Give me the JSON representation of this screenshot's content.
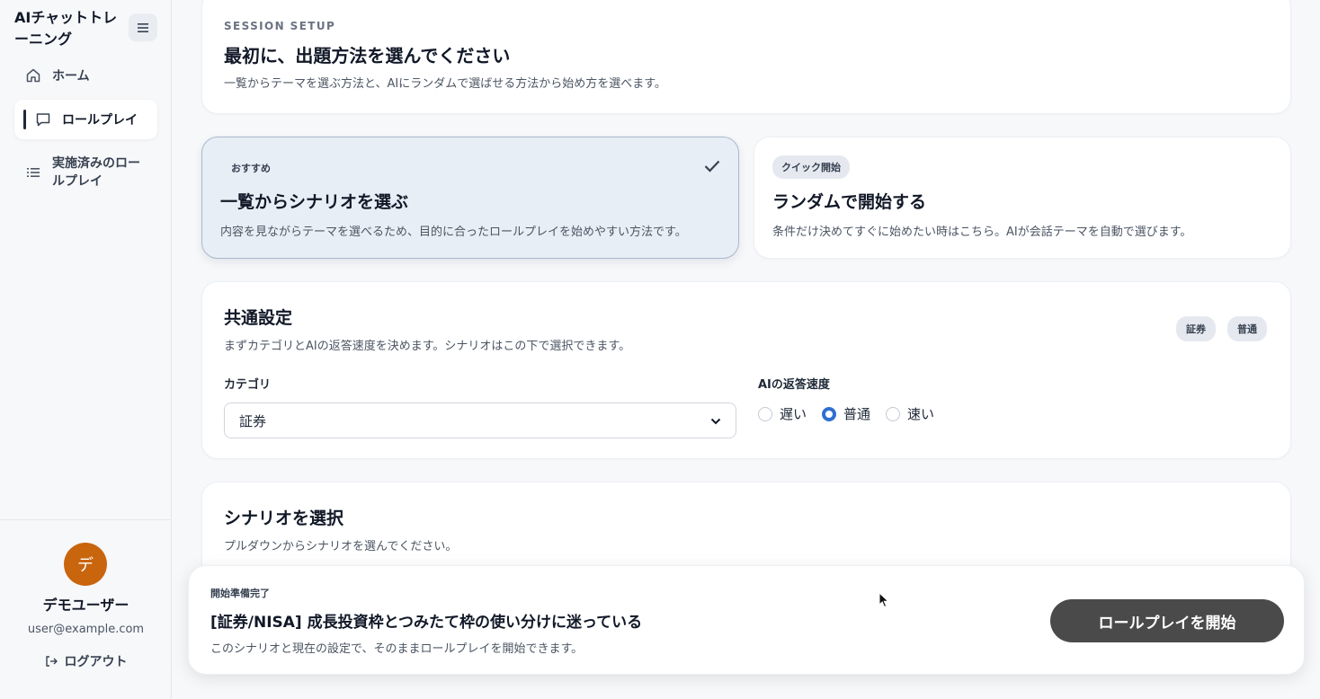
{
  "sidebar": {
    "brand": "AIチャットトレーニング",
    "nav": [
      {
        "label": "ホーム",
        "icon": "home-icon"
      },
      {
        "label": "ロールプレイ",
        "icon": "chat-bubble-icon",
        "active": true
      },
      {
        "label": "実施済みのロールプレイ",
        "icon": "list-icon"
      }
    ],
    "user": {
      "avatar_initial": "デ",
      "name": "デモユーザー",
      "email": "user@example.com"
    },
    "logout_label": "ログアウト"
  },
  "setup": {
    "eyebrow": "SESSION SETUP",
    "title": "最初に、出題方法を選んでください",
    "description": "一覧からテーマを選ぶ方法と、AIにランダムで選ばせる方法から始め方を選べます。"
  },
  "modes": [
    {
      "badge": "おすすめ",
      "title": "一覧からシナリオを選ぶ",
      "description": "内容を見ながらテーマを選べるため、目的に合ったロールプレイを始めやすい方法です。",
      "selected": true
    },
    {
      "badge": "クイック開始",
      "title": "ランダムで開始する",
      "description": "条件だけ決めてすぐに始めたい時はこちら。AIが会話テーマを自動で選びます。",
      "selected": false
    }
  ],
  "common": {
    "title": "共通設定",
    "description": "まずカテゴリとAIの返答速度を決めます。シナリオはこの下で選択できます。",
    "tags": [
      "証券",
      "普通"
    ],
    "category_label": "カテゴリ",
    "category_value": "証券",
    "speed_label": "AIの返答速度",
    "speed_options": [
      "遅い",
      "普通",
      "速い"
    ],
    "speed_selected": "普通"
  },
  "scenario": {
    "title": "シナリオを選択",
    "description": "プルダウンからシナリオを選んでください。"
  },
  "footer": {
    "status": "開始準備完了",
    "scenario_title": "[証券/NISA] 成長投資枠とつみたて枠の使い分けに迷っている",
    "note": "このシナリオと現在の設定で、そのままロールプレイを開始できます。",
    "start_label": "ロールプレイを開始"
  },
  "colors": {
    "accent": "#2f6fd1",
    "avatar": "#c8650d",
    "start_button": "#4a4a4a",
    "selected_card": "#e8eef5"
  }
}
